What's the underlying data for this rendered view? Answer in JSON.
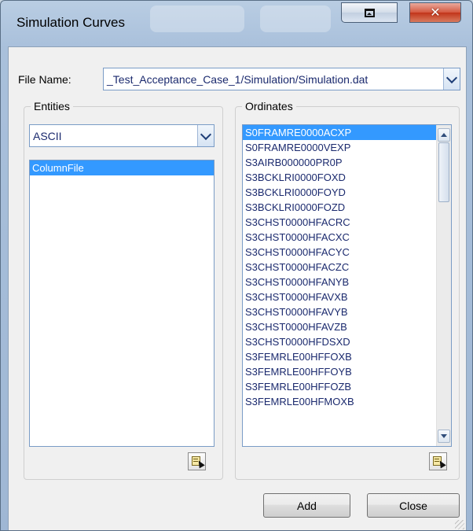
{
  "window": {
    "title": "Simulation Curves",
    "restore_label": "restore",
    "close_label": "close"
  },
  "file_name": {
    "label": "File Name:",
    "value": "_Test_Acceptance_Case_1/Simulation/Simulation.dat"
  },
  "entities": {
    "group_title": "Entities",
    "type_value": "ASCII",
    "items": [
      {
        "label": "ColumnFile",
        "selected": true
      }
    ]
  },
  "ordinates": {
    "group_title": "Ordinates",
    "items": [
      {
        "label": "S0FRAMRE0000ACXP",
        "selected": true
      },
      {
        "label": "S0FRAMRE0000VEXP",
        "selected": false
      },
      {
        "label": "S3AIRB000000PR0P",
        "selected": false
      },
      {
        "label": "S3BCKLRI0000FOXD",
        "selected": false
      },
      {
        "label": "S3BCKLRI0000FOYD",
        "selected": false
      },
      {
        "label": "S3BCKLRI0000FOZD",
        "selected": false
      },
      {
        "label": "S3CHST0000HFACRC",
        "selected": false
      },
      {
        "label": "S3CHST0000HFACXC",
        "selected": false
      },
      {
        "label": "S3CHST0000HFACYC",
        "selected": false
      },
      {
        "label": "S3CHST0000HFACZC",
        "selected": false
      },
      {
        "label": "S3CHST0000HFANYB",
        "selected": false
      },
      {
        "label": "S3CHST0000HFAVXB",
        "selected": false
      },
      {
        "label": "S3CHST0000HFAVYB",
        "selected": false
      },
      {
        "label": "S3CHST0000HFAVZB",
        "selected": false
      },
      {
        "label": "S3CHST0000HFDSXD",
        "selected": false
      },
      {
        "label": "S3FEMRLE00HFFOXB",
        "selected": false
      },
      {
        "label": "S3FEMRLE00HFFOYB",
        "selected": false
      },
      {
        "label": "S3FEMRLE00HFFOZB",
        "selected": false
      },
      {
        "label": "S3FEMRLE00HFMOXB",
        "selected": false
      }
    ]
  },
  "buttons": {
    "add": "Add",
    "close": "Close"
  },
  "icons": {
    "restore": "restore-icon",
    "close": "close-x-icon",
    "dropdown": "chevron-down-icon",
    "pick": "pick-from-list-icon"
  },
  "colors": {
    "selection": "#3399ff",
    "list_text": "#1b2a6e",
    "close_button": "#c2351a"
  }
}
